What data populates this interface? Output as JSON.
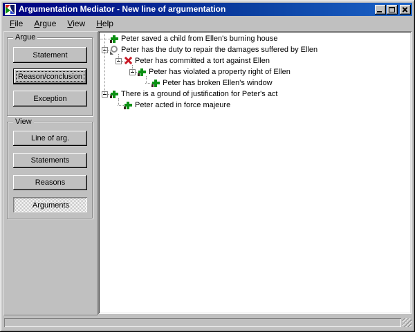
{
  "window": {
    "title": "Argumentation Mediator - New line of argumentation",
    "app_icon": "argumentation-mediator-logo",
    "controls": [
      "minimize",
      "maximize",
      "close"
    ]
  },
  "menu": {
    "items": [
      {
        "label": "File"
      },
      {
        "label": "Argue"
      },
      {
        "label": "View"
      },
      {
        "label": "Help"
      }
    ],
    "underline_first_letter": true
  },
  "sidebar": {
    "groups": [
      {
        "title": "Argue",
        "buttons": [
          {
            "label": "Statement",
            "state": "normal"
          },
          {
            "label": "Reason/conclusion",
            "state": "default-focused"
          },
          {
            "label": "Exception",
            "state": "normal"
          }
        ]
      },
      {
        "title": "View",
        "buttons": [
          {
            "label": "Line of arg.",
            "state": "normal"
          },
          {
            "label": "Statements",
            "state": "normal"
          },
          {
            "label": "Reasons",
            "state": "normal"
          },
          {
            "label": "Arguments",
            "state": "pressed"
          }
        ]
      }
    ]
  },
  "tree": {
    "rows": [
      {
        "level": 0,
        "expander": false,
        "icon": "pro-plus-icon",
        "text": "Peter saved a child from Ellen's burning house"
      },
      {
        "level": 0,
        "expander": true,
        "icon": "issue-circle-icon",
        "text": "Peter has the duty to repair the damages suffered by Ellen"
      },
      {
        "level": 1,
        "expander": true,
        "icon": "con-x-icon",
        "text": "Peter has committed a tort against Ellen"
      },
      {
        "level": 2,
        "expander": true,
        "icon": "pro-plus-icon",
        "text": "Peter has violated a property right of Ellen"
      },
      {
        "level": 3,
        "expander": false,
        "icon": "pro-plus-icon",
        "text": "Peter has broken Ellen's window"
      },
      {
        "level": 0,
        "expander": true,
        "icon": "pro-plus-icon",
        "text": "There is a ground of justification for Peter's act"
      },
      {
        "level": 1,
        "expander": false,
        "icon": "pro-plus-icon",
        "text": "Peter acted in force majeure"
      }
    ]
  },
  "statusbar": {
    "text": ""
  },
  "colors": {
    "titlebar_start": "#000080",
    "titlebar_end": "#1b63c8",
    "face": "#c0c0c0",
    "pro_green": "#0c9014",
    "con_red": "#c81826",
    "issue_gray": "#8e8e8e"
  }
}
